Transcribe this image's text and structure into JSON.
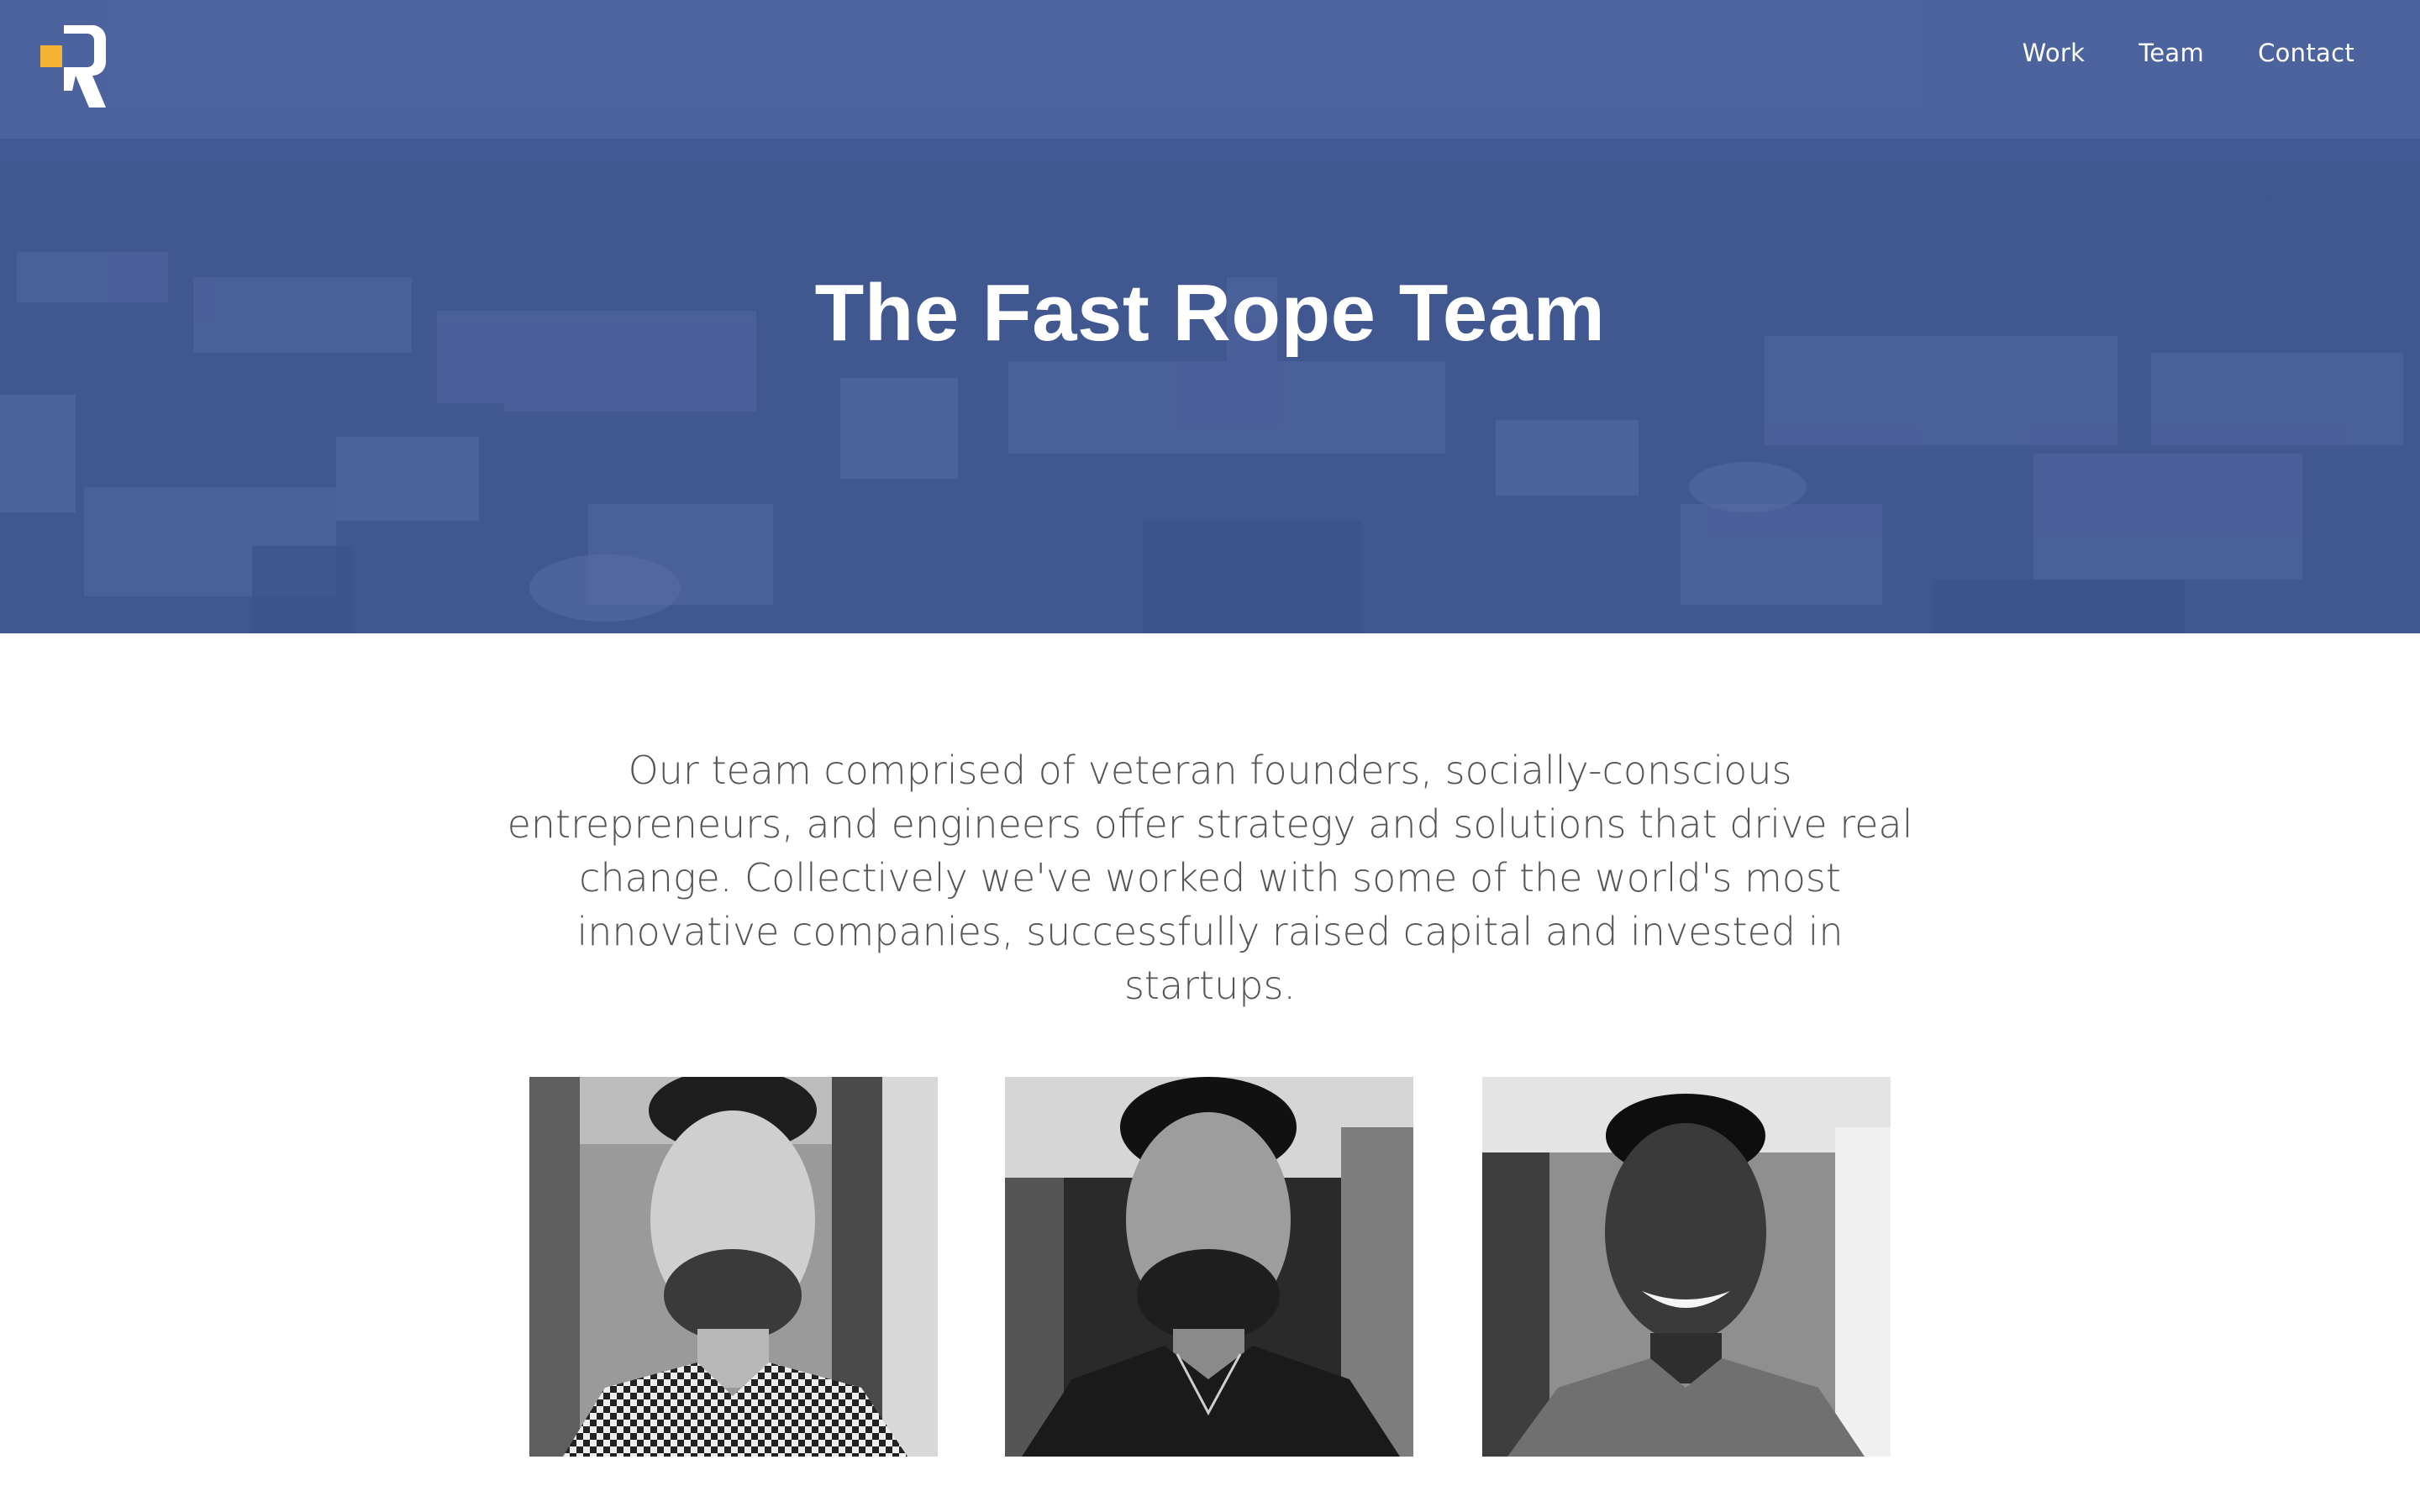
{
  "header": {
    "logo_icon": "fast-rope-r-logo",
    "nav": [
      {
        "label": "Work"
      },
      {
        "label": "Team"
      },
      {
        "label": "Contact"
      }
    ]
  },
  "hero": {
    "title": "The Fast Rope Team"
  },
  "intro": {
    "text": "Our team comprised of veteran founders, socially-conscious entrepreneurs, and engineers offer strategy and solutions that drive real change. Collectively we've worked with some of the world's most innovative companies, successfully raised capital and invested in startups."
  },
  "team": {
    "members": [
      {
        "photo": "team-member-photo-1"
      },
      {
        "photo": "team-member-photo-2"
      },
      {
        "photo": "team-member-photo-3"
      }
    ]
  },
  "colors": {
    "hero_tint": "#4a5d90",
    "logo_accent": "#f6b333",
    "text_white": "#ffffff",
    "body_text": "#555555"
  }
}
